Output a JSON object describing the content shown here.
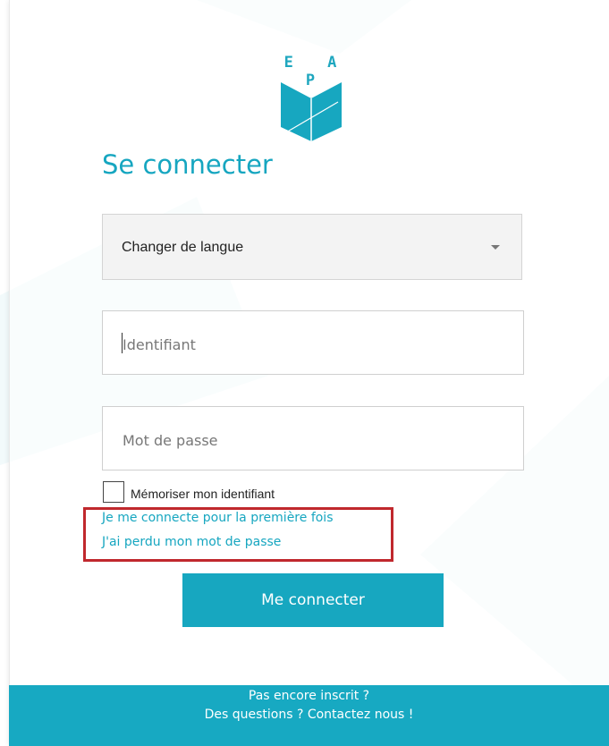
{
  "logo": {
    "text": "E A P",
    "icon": "open-book-icon"
  },
  "title": "Se connecter",
  "language_select": {
    "label": "Changer de langue",
    "icon": "chevron-down-icon"
  },
  "username": {
    "placeholder": "Identifiant"
  },
  "password": {
    "placeholder": "Mot de passe"
  },
  "remember": {
    "label": "Mémoriser mon identifiant",
    "checked": false
  },
  "links": {
    "first_login": "Je me connecte pour la première fois",
    "forgot_password": "J'ai perdu mon mot de passe"
  },
  "submit_label": "Me connecter",
  "footer": {
    "not_registered": "Pas encore inscrit ?",
    "contact": "Des questions ? Contactez nous !"
  },
  "colors": {
    "accent": "#17a7c0",
    "highlight_border": "#c0282d"
  }
}
